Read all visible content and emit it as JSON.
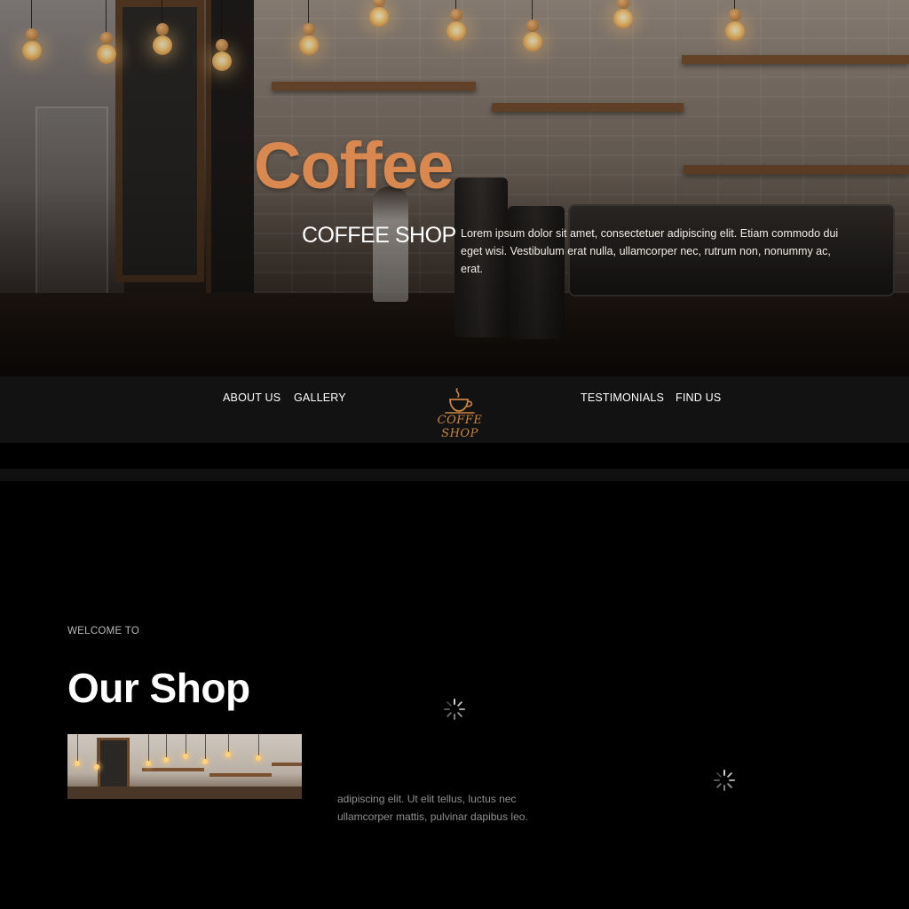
{
  "hero": {
    "title": "Coffee",
    "subtitle": "COFFEE SHOP",
    "description": "Lorem ipsum dolor sit amet, consectetuer adipiscing elit. Etiam commodo dui eget wisi. Vestibulum erat nulla, ullamcorper nec, rutrum non, nonummy ac, erat."
  },
  "nav": {
    "links_left": [
      "ABOUT US",
      "GALLERY"
    ],
    "links_right": [
      "TESTIMONIALS",
      "FIND US"
    ],
    "logo_text": "COFFE SHOP",
    "logo_icon": "coffee-cup-icon"
  },
  "shop": {
    "eyebrow": "WELCOME TO",
    "title": "Our Shop",
    "text_line_1": "adipiscing elit. Ut elit tellus, luctus nec",
    "text_line_2": "ullamcorper mattis, pulvinar dapibus leo.",
    "loading_icon": "loading-spinner-icon"
  },
  "colors": {
    "accent": "#d9884f",
    "logo": "#c98542",
    "nav_background": "#121212",
    "page_background": "#000000"
  }
}
